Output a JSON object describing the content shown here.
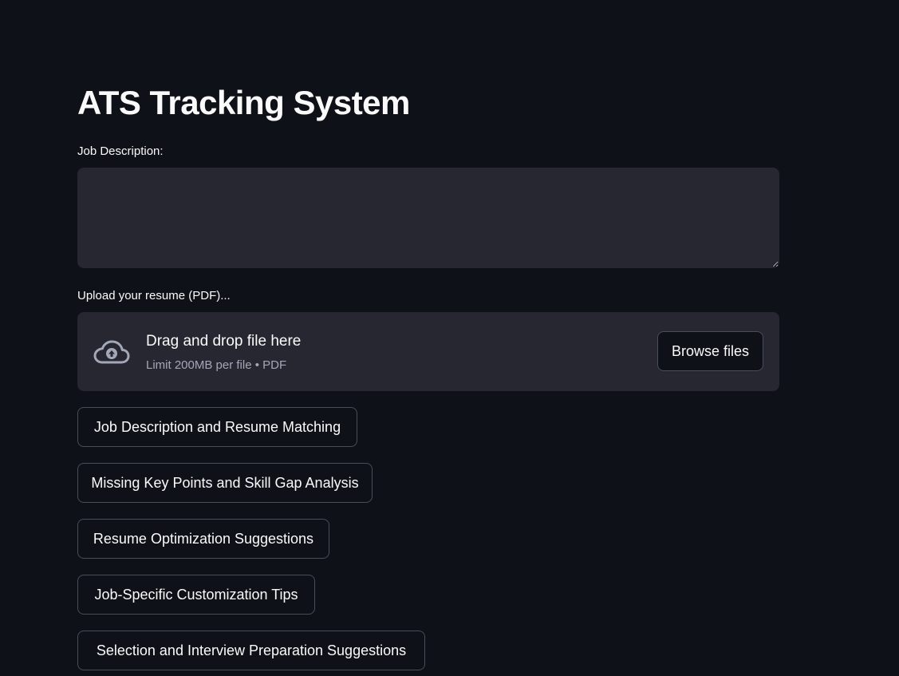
{
  "page": {
    "title": "ATS Tracking System"
  },
  "job_description": {
    "label": "Job Description:",
    "value": ""
  },
  "upload": {
    "label": "Upload your resume (PDF)...",
    "drop_title": "Drag and drop file here",
    "limit_text": "Limit 200MB per file • PDF",
    "browse_label": "Browse files",
    "icon": "cloud-upload-icon"
  },
  "actions": [
    {
      "label": "Job Description and Resume Matching"
    },
    {
      "label": "Missing Key Points and Skill Gap Analysis"
    },
    {
      "label": "Resume Optimization Suggestions"
    },
    {
      "label": "Job-Specific Customization Tips"
    },
    {
      "label": "Selection and Interview Preparation Suggestions"
    }
  ],
  "colors": {
    "background": "#0e1117",
    "surface": "#262730",
    "text": "#fafafa",
    "muted_text": "#a3a8b8",
    "border": "#4a4d58"
  }
}
